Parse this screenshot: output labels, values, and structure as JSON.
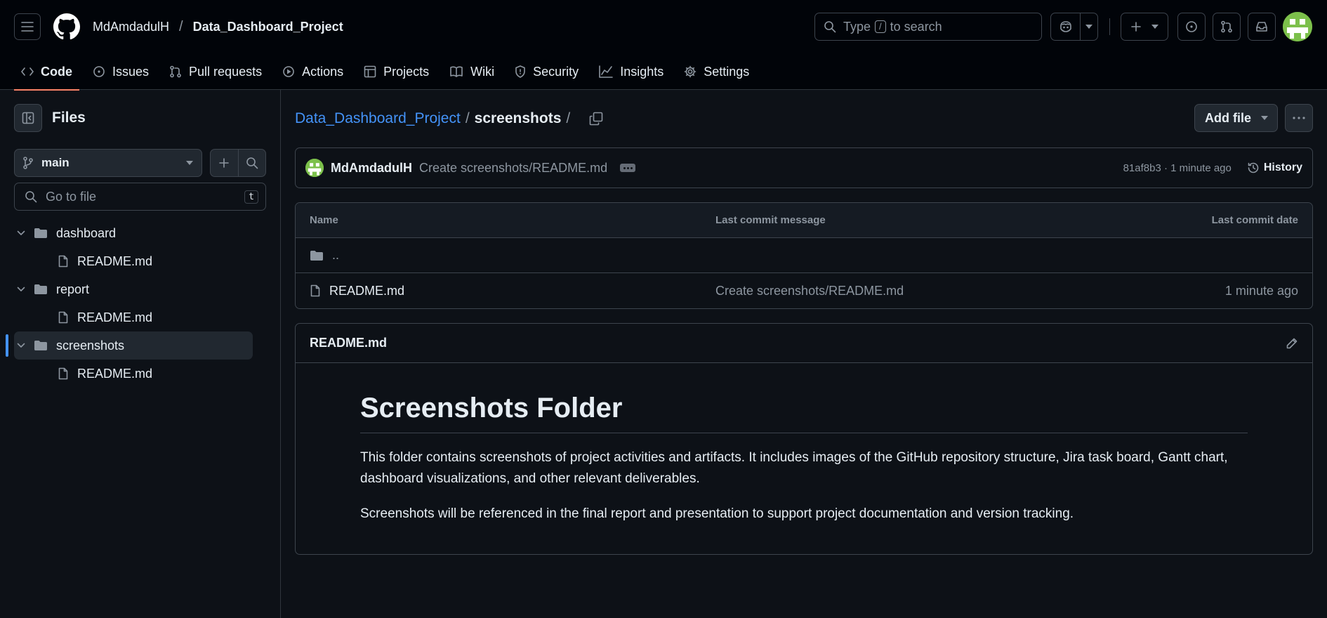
{
  "header": {
    "owner": "MdAmdadulH",
    "separator": "/",
    "repo": "Data_Dashboard_Project",
    "search": {
      "prefix": "Type",
      "key": "/",
      "suffix": "to search"
    },
    "avatar_color": "#7cc04b"
  },
  "tabs": [
    {
      "label": "Code",
      "icon": "code-icon",
      "active": true
    },
    {
      "label": "Issues",
      "icon": "issue-icon"
    },
    {
      "label": "Pull requests",
      "icon": "pull-request-icon"
    },
    {
      "label": "Actions",
      "icon": "play-icon"
    },
    {
      "label": "Projects",
      "icon": "table-icon"
    },
    {
      "label": "Wiki",
      "icon": "book-icon"
    },
    {
      "label": "Security",
      "icon": "shield-icon"
    },
    {
      "label": "Insights",
      "icon": "graph-icon"
    },
    {
      "label": "Settings",
      "icon": "gear-icon"
    }
  ],
  "sidebar": {
    "title": "Files",
    "branch": "main",
    "go_to_file": "Go to file",
    "go_to_file_key": "t",
    "tree": [
      {
        "name": "dashboard",
        "type": "folder"
      },
      {
        "name": "README.md",
        "type": "file"
      },
      {
        "name": "report",
        "type": "folder"
      },
      {
        "name": "README.md",
        "type": "file"
      },
      {
        "name": "screenshots",
        "type": "folder",
        "selected": true
      },
      {
        "name": "README.md",
        "type": "file"
      }
    ]
  },
  "breadcrumb": {
    "repo": "Data_Dashboard_Project",
    "sep": "/",
    "folder": "screenshots",
    "trail": "/"
  },
  "actions": {
    "add_file": "Add file"
  },
  "commit": {
    "author": "MdAmdadulH",
    "message": "Create screenshots/README.md",
    "sha_time": "81af8b3 · 1 minute ago",
    "history": "History"
  },
  "table": {
    "headers": {
      "name": "Name",
      "message": "Last commit message",
      "date": "Last commit date"
    },
    "parent": "..",
    "rows": [
      {
        "name": "README.md",
        "message": "Create screenshots/README.md",
        "date": "1 minute ago"
      }
    ]
  },
  "readme": {
    "filename": "README.md",
    "heading": "Screenshots Folder",
    "p1": "This folder contains screenshots of project activities and artifacts. It includes images of the GitHub repository structure, Jira task board, Gantt chart, dashboard visualizations, and other relevant deliverables.",
    "p2": "Screenshots will be referenced in the final report and presentation to support project documentation and version tracking."
  },
  "colors": {
    "accent": "#4493f8",
    "tab_underline": "#f78166",
    "bg": "#0d1117"
  }
}
